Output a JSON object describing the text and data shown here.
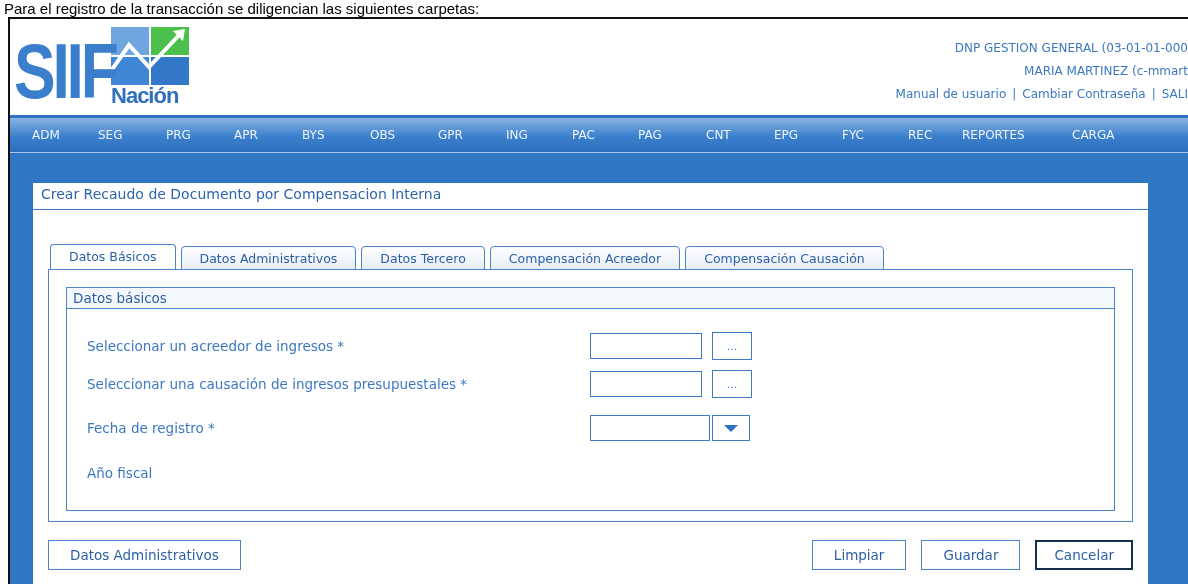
{
  "caption": "Para el registro de la transacción se diligencian las siguientes carpetas:",
  "logo": {
    "main": "SIIF",
    "sub": "Nación"
  },
  "header": {
    "organization": "DNP GESTION GENERAL (03-01-01-000",
    "user": "MARIA MARTINEZ (c-mmart",
    "links": [
      "Manual de usuario",
      "Cambiar Contraseña",
      "SALI"
    ],
    "link_separators": [
      "|",
      "|"
    ]
  },
  "menu": [
    "ADM",
    "SEG",
    "PRG",
    "APR",
    "BYS",
    "OBS",
    "GPR",
    "ING",
    "PAC",
    "PAG",
    "CNT",
    "EPG",
    "FYC",
    "REC",
    "REPORTES",
    "CARGA"
  ],
  "panel": {
    "title": "Crear Recaudo de Documento por Compensacion Interna"
  },
  "tabs": [
    {
      "label": "Datos Básicos",
      "selected": true
    },
    {
      "label": "Datos Administrativos",
      "selected": false
    },
    {
      "label": "Datos Tercero",
      "selected": false
    },
    {
      "label": "Compensación Acreedor",
      "selected": false
    },
    {
      "label": "Compensación Causación",
      "selected": false
    }
  ],
  "section": {
    "title": "Datos básicos",
    "fields": [
      {
        "kind": "lookup",
        "label": "Seleccionar un acreedor de ingresos *",
        "button": "..."
      },
      {
        "kind": "lookup",
        "label": "Seleccionar una causación de ingresos presupuestales *",
        "button": "..."
      },
      {
        "kind": "date",
        "label": "Fecha de registro *"
      },
      {
        "kind": "text",
        "label": "Año fiscal"
      }
    ]
  },
  "buttons_left": [
    {
      "label": "Datos Administrativos",
      "focused": false
    }
  ],
  "buttons_right": [
    {
      "label": "Limpiar",
      "focused": false
    },
    {
      "label": "Guardar",
      "focused": false
    },
    {
      "label": "Cancelar",
      "focused": true
    }
  ]
}
